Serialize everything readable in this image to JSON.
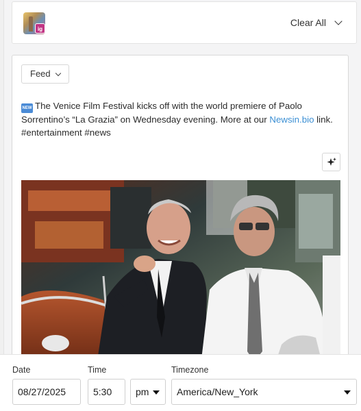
{
  "account": {
    "network_badge": "ig",
    "clear_all_label": "Clear All"
  },
  "post": {
    "feed_label": "Feed",
    "new_badge": "NEW",
    "caption_before_link": "The Venice Film Festival kicks off with the world premiere of Paolo Sorrentino’s “La Grazia” on Wednesday evening. More at our ",
    "caption_link": "Newsin.bio",
    "caption_after_link": " link.",
    "hashtags": "#entertainment #news"
  },
  "schedule": {
    "date_label": "Date",
    "date_value": "08/27/2025",
    "time_label": "Time",
    "time_value": "5:30",
    "ampm_value": "pm",
    "timezone_label": "Timezone",
    "timezone_value": "America/New_York"
  },
  "colors": {
    "link": "#3b8fd4",
    "instagram_badge": "#c13584",
    "new_badge": "#4a8bd6"
  },
  "icons": {
    "account_dropdown": "chevron-down-icon",
    "feed_dropdown": "chevron-down-icon",
    "ai_assist": "sparkle-icon",
    "select_caret": "caret-down-icon"
  }
}
